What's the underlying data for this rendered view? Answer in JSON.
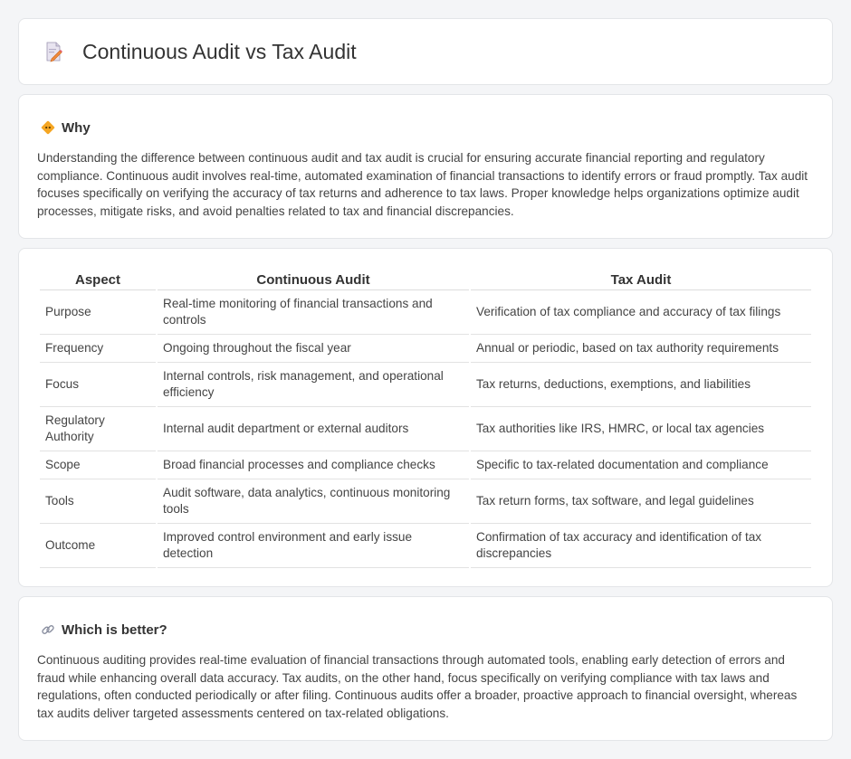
{
  "header": {
    "title": "Continuous Audit vs Tax Audit",
    "icon": "document-edit-icon"
  },
  "why": {
    "icon": "bulb-diamond-icon",
    "title": "Why",
    "text": "Understanding the difference between continuous audit and tax audit is crucial for ensuring accurate financial reporting and regulatory compliance. Continuous audit involves real-time, automated examination of financial transactions to identify errors or fraud promptly. Tax audit focuses specifically on verifying the accuracy of tax returns and adherence to tax laws. Proper knowledge helps organizations optimize audit processes, mitigate risks, and avoid penalties related to tax and financial discrepancies."
  },
  "comparison": {
    "headers": [
      "Aspect",
      "Continuous Audit",
      "Tax Audit"
    ],
    "rows": [
      {
        "aspect": "Purpose",
        "continuous": "Real-time monitoring of financial transactions and controls",
        "tax": "Verification of tax compliance and accuracy of tax filings"
      },
      {
        "aspect": "Frequency",
        "continuous": "Ongoing throughout the fiscal year",
        "tax": "Annual or periodic, based on tax authority requirements"
      },
      {
        "aspect": "Focus",
        "continuous": "Internal controls, risk management, and operational efficiency",
        "tax": "Tax returns, deductions, exemptions, and liabilities"
      },
      {
        "aspect": "Regulatory Authority",
        "continuous": "Internal audit department or external auditors",
        "tax": "Tax authorities like IRS, HMRC, or local tax agencies"
      },
      {
        "aspect": "Scope",
        "continuous": "Broad financial processes and compliance checks",
        "tax": "Specific to tax-related documentation and compliance"
      },
      {
        "aspect": "Tools",
        "continuous": "Audit software, data analytics, continuous monitoring tools",
        "tax": "Tax return forms, tax software, and legal guidelines"
      },
      {
        "aspect": "Outcome",
        "continuous": "Improved control environment and early issue detection",
        "tax": "Confirmation of tax accuracy and identification of tax discrepancies"
      }
    ]
  },
  "better": {
    "icon": "link-icon",
    "title": "Which is better?",
    "text": "Continuous auditing provides real-time evaluation of financial transactions through automated tools, enabling early detection of errors and fraud while enhancing overall data accuracy. Tax audits, on the other hand, focus specifically on verifying compliance with tax laws and regulations, often conducted periodically or after filing. Continuous audits offer a broader, proactive approach to financial oversight, whereas tax audits deliver targeted assessments centered on tax-related obligations."
  }
}
